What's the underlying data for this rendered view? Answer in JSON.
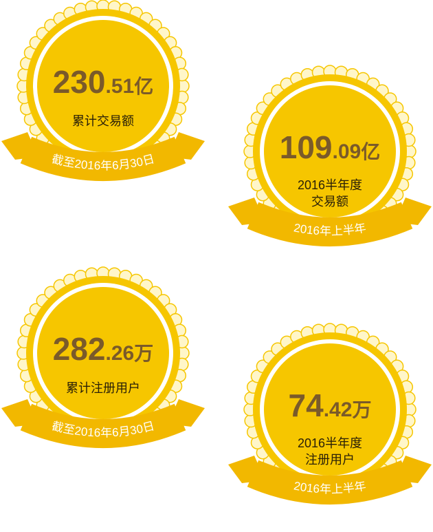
{
  "colors": {
    "gold": "#f6c600",
    "ribbon": "#f2b800",
    "ribbon_dark": "#cf8f00",
    "scallop": "#fff6c9",
    "text_brown": "#7a5a2a"
  },
  "badges": [
    {
      "int": "230",
      "dec": ".51",
      "unit": "亿",
      "label": "累计交易额",
      "ribbon": "截至2016年6月30日"
    },
    {
      "int": "109",
      "dec": ".09",
      "unit": "亿",
      "label": "2016半年度\n交易额",
      "ribbon": "2016年上半年"
    },
    {
      "int": "282",
      "dec": ".26",
      "unit": "万",
      "label": "累计注册用户",
      "ribbon": "截至2016年6月30日"
    },
    {
      "int": "74",
      "dec": ".42",
      "unit": "万",
      "label": "2016半年度\n注册用户",
      "ribbon": "2016年上半年"
    }
  ]
}
